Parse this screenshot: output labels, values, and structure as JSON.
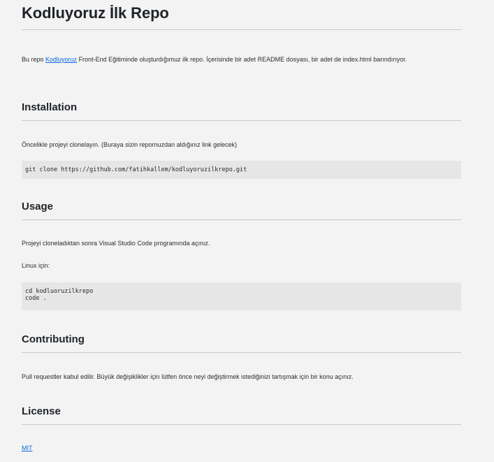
{
  "title": "Kodluyoruz İlk Repo",
  "intro": {
    "before_link": "Bu repo ",
    "link_text": "Kodluyoruz",
    "after_link": " Front-End Eğitiminde oluşturdığımuz ilk repo. İçerisinde bir adet README dosyası, bir adet de index.html barındırıyor."
  },
  "installation": {
    "heading": "Installation",
    "text": "Öncelikle projeyi clonelayın. (Buraya sizin repornuzdan aldığınız link gelecek)",
    "code": "git clone https://github.com/fatihkallem/kodluyoruzilkrepo.git"
  },
  "usage": {
    "heading": "Usage",
    "text1": "Projeyi cloneladıktan sonra Visual Studio Code programında açınız.",
    "text2": "Linux için:",
    "code_lines": [
      "cd kodluoruzilkrepo",
      "code ."
    ]
  },
  "contributing": {
    "heading": "Contributing",
    "text": "Pull requestler kabul edilir. Büyük değişiklikler için lütfen önce neyi değiştirmek istediğinizi tartışmak için bir konu açınız."
  },
  "license": {
    "heading": "License",
    "link_text": "MIT"
  }
}
